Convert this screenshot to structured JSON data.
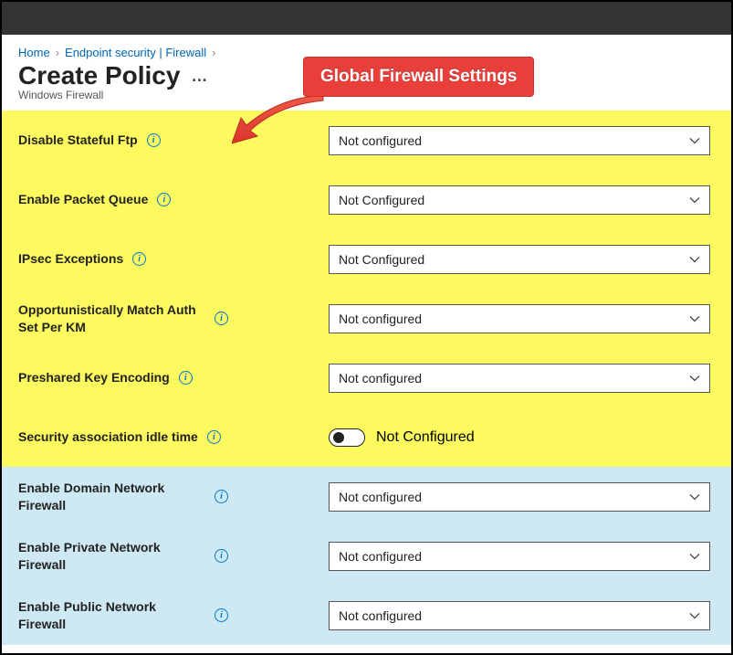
{
  "breadcrumb": {
    "home": "Home",
    "mid": "Endpoint security | Firewall"
  },
  "page": {
    "title": "Create Policy",
    "subtitle": "Windows Firewall"
  },
  "callout": {
    "text": "Global Firewall Settings"
  },
  "settings_yellow": [
    {
      "label": "Disable Stateful Ftp",
      "value": "Not configured",
      "type": "select"
    },
    {
      "label": "Enable Packet Queue",
      "value": "Not Configured",
      "type": "select"
    },
    {
      "label": "IPsec Exceptions",
      "value": "Not Configured",
      "type": "select"
    },
    {
      "label": "Opportunistically Match Auth Set Per KM",
      "value": "Not configured",
      "type": "select"
    },
    {
      "label": "Preshared Key Encoding",
      "value": "Not configured",
      "type": "select"
    },
    {
      "label": "Security association idle time",
      "value": "Not Configured",
      "type": "toggle"
    }
  ],
  "settings_blue": [
    {
      "label": "Enable Domain Network Firewall",
      "value": "Not configured",
      "type": "select"
    },
    {
      "label": "Enable Private Network Firewall",
      "value": "Not configured",
      "type": "select"
    },
    {
      "label": "Enable Public Network Firewall",
      "value": "Not configured",
      "type": "select"
    }
  ]
}
